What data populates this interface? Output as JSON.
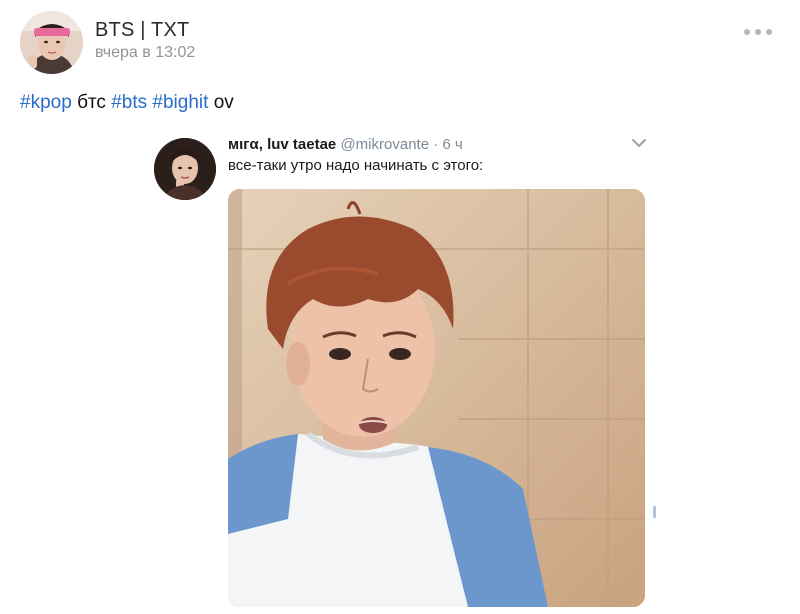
{
  "post": {
    "author": "BTS | TXT",
    "time": "вчера в 13:02",
    "text_parts": {
      "tag1": "#kpop",
      "word1": "бтс",
      "tag2": "#bts",
      "tag3": "#bighit",
      "word2": "ov"
    }
  },
  "tweet": {
    "name": "мιгα, luv taetae",
    "handle": "@mikrovante",
    "separator": "·",
    "time": "6 ч",
    "text": "все-таки утро надо начинать с этого:"
  },
  "icons": {
    "more": "more-dots-icon",
    "chevron": "chevron-down-icon"
  },
  "colors": {
    "hashtag": "#2a6cc7",
    "secondary_text": "#939393",
    "tweet_secondary": "#7d8a96"
  }
}
